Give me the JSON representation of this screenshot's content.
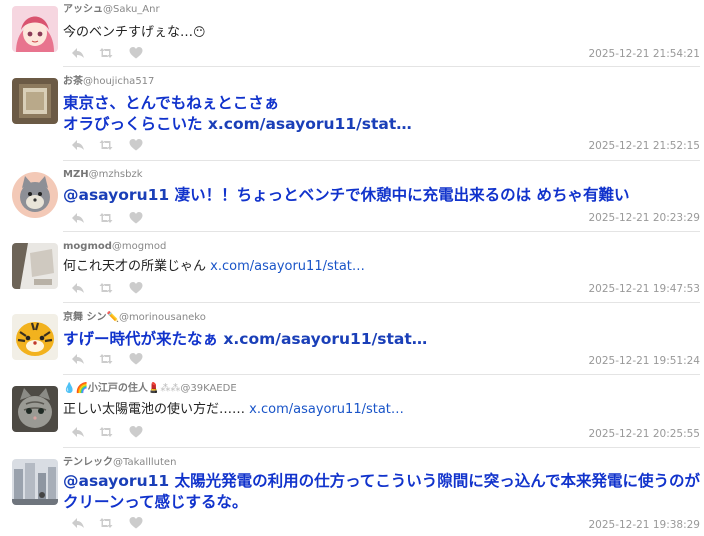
{
  "posts": [
    {
      "display_name": "アッシュ",
      "handle": "@Saku_Anr",
      "text": "今のベンチすげぇな…",
      "emoji": "😶",
      "link": "",
      "time": "2025-12-21 21:54:21",
      "avatar_icon": "anime-girl-avatar"
    },
    {
      "display_name": "お茶",
      "handle": "@houjicha517",
      "text_line1": "東京さ、とんでもねぇとこさぁ",
      "text_line2": "オラびっくらこいた",
      "link": "x.com/asayoru11/stat…",
      "time": "2025-12-21 21:52:15",
      "avatar_icon": "framed-photo-avatar"
    },
    {
      "display_name": "MZH",
      "handle": "@mzhsbzk",
      "mention": "@asayoru11",
      "text": " 凄い！！ちょっとベンチで休憩中に充電出来るのは めちゃ有難い",
      "time": "2025-12-21 20:23:29",
      "avatar_icon": "cartoon-cat-avatar"
    },
    {
      "display_name": "mogmod",
      "handle": "@mogmod",
      "text": "何これ天才の所業じゃん ",
      "link": "x.com/asayoru11/stat…",
      "time": "2025-12-21 19:47:53",
      "avatar_icon": "photo-avatar"
    },
    {
      "display_name": "京舞 シン",
      "handle": "@morinousaneko",
      "text": "すげー時代が来たなぁ ",
      "link": "x.com/asayoru11/stat…",
      "time": "2025-12-21 19:51:24",
      "avatar_icon": "tiger-avatar"
    },
    {
      "display_name": "💧🌈小江戸の住人",
      "handle": "@39KAEDE",
      "text": "正しい太陽電池の使い方だ…… ",
      "link": "x.com/asayoru11/stat…",
      "time": "2025-12-21 20:25:55",
      "avatar_icon": "cat-photo-avatar"
    },
    {
      "display_name": "テンレック",
      "handle": "@Takallluten",
      "mention": "@asayoru11",
      "text_line1": " 太陽光発電の利用の仕方ってこういう隙間に突っ込んで本来発電に使うのが",
      "text_line2": "クリーンって感じするな。",
      "time": "2025-12-21 19:38:29",
      "avatar_icon": "city-photo-avatar"
    }
  ],
  "colors": {
    "link": "#1a3fb8",
    "timestamp": "#999999",
    "action_icon": "#cccccc"
  },
  "action_icons": [
    "reply-icon",
    "retweet-icon",
    "like-icon"
  ]
}
